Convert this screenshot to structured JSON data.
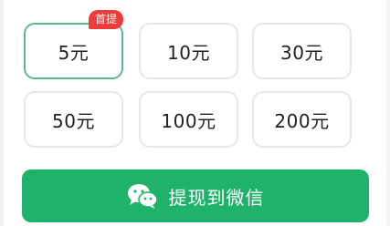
{
  "amount_options": [
    {
      "label": "5元",
      "selected": true
    },
    {
      "label": "10元",
      "selected": false
    },
    {
      "label": "30元",
      "selected": false
    },
    {
      "label": "50元",
      "selected": false
    },
    {
      "label": "100元",
      "selected": false
    },
    {
      "label": "200元",
      "selected": false
    }
  ],
  "first_withdraw_badge": "首提",
  "withdraw_button": {
    "label": "提现到微信",
    "icon": "wechat-icon"
  },
  "colors": {
    "selected_border": "#5ab98a",
    "badge": "#ee3b3b",
    "button": "#1fb26a"
  }
}
